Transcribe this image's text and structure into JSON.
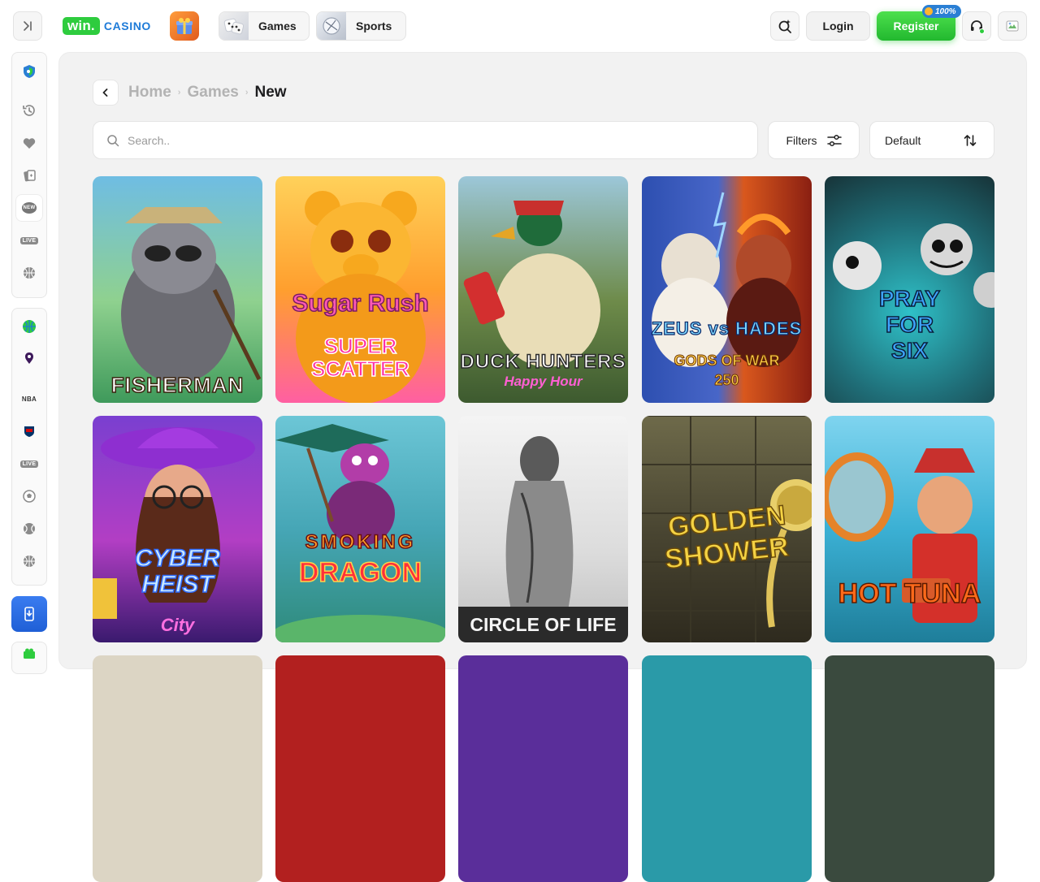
{
  "brand": {
    "win": "win.",
    "casino": "CASINO"
  },
  "header": {
    "games_label": "Games",
    "sports_label": "Sports",
    "login_label": "Login",
    "register_label": "Register",
    "bonus_badge": "100%"
  },
  "sidebar": {
    "live_badge": "LIVE",
    "new_badge": "NEW",
    "nba_label": "NBA",
    "live_badge_2": "LIVE"
  },
  "breadcrumb": {
    "home": "Home",
    "games": "Games",
    "current": "New"
  },
  "search": {
    "placeholder": "Search.."
  },
  "filters": {
    "label": "Filters"
  },
  "sort": {
    "selected": "Default"
  },
  "games": [
    {
      "title": "FISHERMAN",
      "bg": "#3f9a5b"
    },
    {
      "title": "Sugar Rush",
      "subtitle": "SUPER SCATTER",
      "bg": "#ffb33a"
    },
    {
      "title": "DUCK HUNTERS",
      "subtitle": "Happy Hour",
      "bg": "#4c6a3f"
    },
    {
      "title": "ZEUS vs HADES",
      "subtitle": "GODS OF WAR 250",
      "bg": "#2a3d8f"
    },
    {
      "title": "PRAY FOR SIX",
      "bg": "#1c3a40"
    },
    {
      "title": "CYBER HEIST",
      "subtitle": "City",
      "bg": "#5a2ea6"
    },
    {
      "title": "SMOKING",
      "subtitle": "DRAGON",
      "bg": "#3ba3b0"
    },
    {
      "title": "CIRCLE OF LIFE",
      "bg": "#d9d9d9"
    },
    {
      "title": "GOLDEN",
      "subtitle": "SHOWER",
      "bg": "#3a3424"
    },
    {
      "title": "HOT TUNA",
      "bg": "#2aa0c8"
    }
  ],
  "colors": {
    "accent_green": "#2ecc3e",
    "brand_blue": "#1e7bd8",
    "panel_bg": "#f2f2f2"
  }
}
